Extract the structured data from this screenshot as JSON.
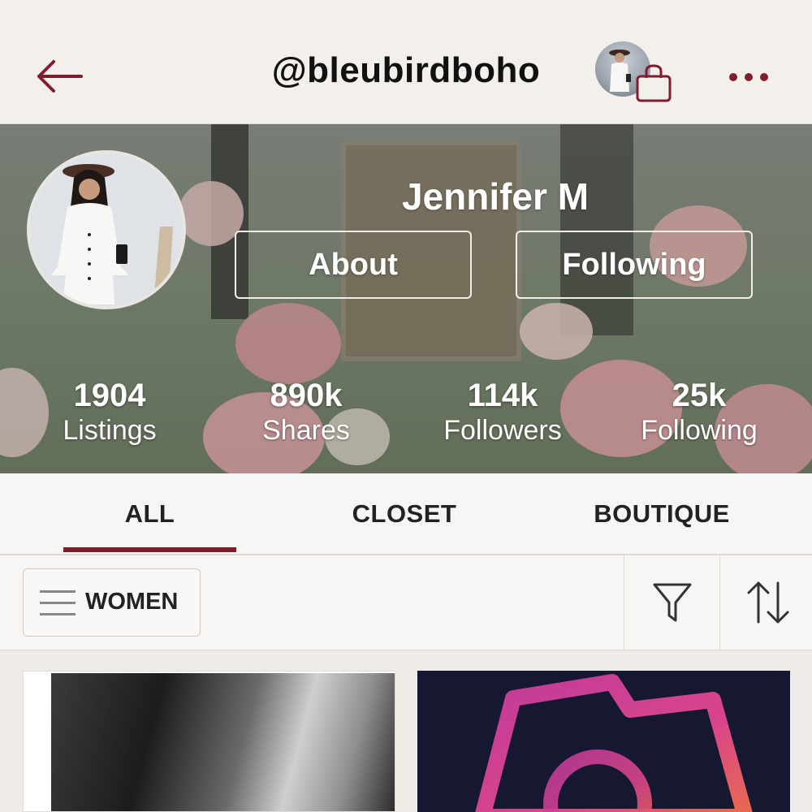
{
  "header": {
    "username": "@bleubirdboho"
  },
  "profile": {
    "display_name": "Jennifer M",
    "about_label": "About",
    "following_label": "Following"
  },
  "stats": [
    {
      "value": "1904",
      "label": "Listings"
    },
    {
      "value": "890k",
      "label": "Shares"
    },
    {
      "value": "114k",
      "label": "Followers"
    },
    {
      "value": "25k",
      "label": "Following"
    }
  ],
  "tabs": {
    "items": [
      "ALL",
      "CLOSET",
      "BOUTIQUE"
    ],
    "active": "ALL"
  },
  "filters": {
    "category_label": "WOMEN"
  },
  "colors": {
    "accent": "#7f1d2e",
    "header_bg": "#f3f0ec",
    "text": "#222222"
  },
  "icons": {
    "back": "back-arrow-icon",
    "bag": "shopping-bag-icon",
    "more": "more-dots-icon",
    "menu": "menu-lines-icon",
    "filter": "funnel-filter-icon",
    "sort": "sort-arrows-icon"
  }
}
